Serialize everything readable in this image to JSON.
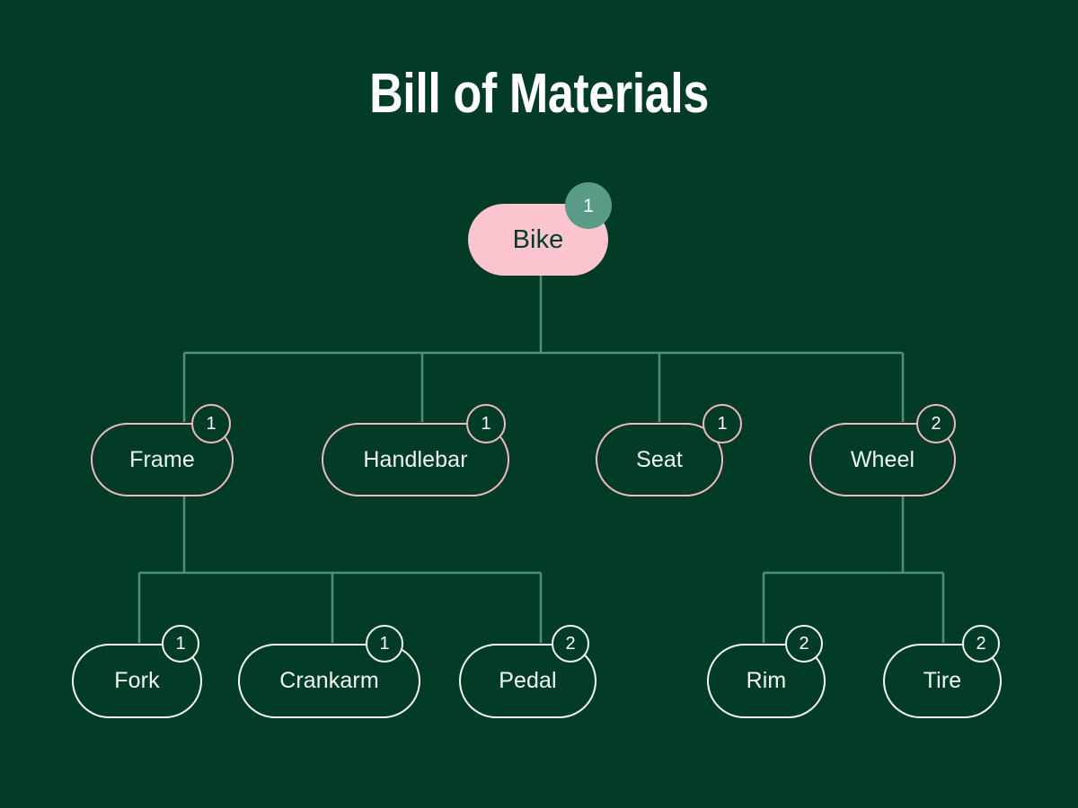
{
  "page": {
    "title": "Bill of Materials",
    "background_color": "#023c27"
  },
  "colors": {
    "background": "#023c27",
    "title_text": "#ffffff",
    "root_fill": "#fbc4ce",
    "root_text": "#023c27",
    "badge_teal_fill": "#5a9b87",
    "pink_outline": "#f2b9c4",
    "white_outline": "#f2f7f4",
    "connector": "#4e9179",
    "node_text": "#f4f9f6"
  },
  "chart_data": {
    "type": "diagram",
    "title": "Bill of Materials",
    "layout": "top-down tree",
    "levels": 3,
    "nodes": [
      {
        "id": "bike",
        "label": "Bike",
        "quantity": "1",
        "level": 0,
        "style": "filled-pink",
        "badge_style": "teal"
      },
      {
        "id": "frame",
        "label": "Frame",
        "quantity": "1",
        "level": 1,
        "style": "outline-pink",
        "badge_style": "pink"
      },
      {
        "id": "handlebar",
        "label": "Handlebar",
        "quantity": "1",
        "level": 1,
        "style": "outline-pink",
        "badge_style": "pink"
      },
      {
        "id": "seat",
        "label": "Seat",
        "quantity": "1",
        "level": 1,
        "style": "outline-pink",
        "badge_style": "pink"
      },
      {
        "id": "wheel",
        "label": "Wheel",
        "quantity": "2",
        "level": 1,
        "style": "outline-pink",
        "badge_style": "pink"
      },
      {
        "id": "fork",
        "label": "Fork",
        "quantity": "1",
        "level": 2,
        "style": "outline-white",
        "badge_style": "white"
      },
      {
        "id": "crankarm",
        "label": "Crankarm",
        "quantity": "1",
        "level": 2,
        "style": "outline-white",
        "badge_style": "white"
      },
      {
        "id": "pedal",
        "label": "Pedal",
        "quantity": "2",
        "level": 2,
        "style": "outline-white",
        "badge_style": "white"
      },
      {
        "id": "rim",
        "label": "Rim",
        "quantity": "2",
        "level": 2,
        "style": "outline-white",
        "badge_style": "white"
      },
      {
        "id": "tire",
        "label": "Tire",
        "quantity": "2",
        "level": 2,
        "style": "outline-white",
        "badge_style": "white"
      }
    ],
    "edges": [
      {
        "from": "bike",
        "to": "frame"
      },
      {
        "from": "bike",
        "to": "handlebar"
      },
      {
        "from": "bike",
        "to": "seat"
      },
      {
        "from": "bike",
        "to": "wheel"
      },
      {
        "from": "frame",
        "to": "fork"
      },
      {
        "from": "frame",
        "to": "crankarm"
      },
      {
        "from": "frame",
        "to": "pedal"
      },
      {
        "from": "wheel",
        "to": "rim"
      },
      {
        "from": "wheel",
        "to": "tire"
      }
    ]
  },
  "nodes": {
    "bike": {
      "label": "Bike",
      "quantity": "1"
    },
    "frame": {
      "label": "Frame",
      "quantity": "1"
    },
    "handlebar": {
      "label": "Handlebar",
      "quantity": "1"
    },
    "seat": {
      "label": "Seat",
      "quantity": "1"
    },
    "wheel": {
      "label": "Wheel",
      "quantity": "2"
    },
    "fork": {
      "label": "Fork",
      "quantity": "1"
    },
    "crankarm": {
      "label": "Crankarm",
      "quantity": "1"
    },
    "pedal": {
      "label": "Pedal",
      "quantity": "2"
    },
    "rim": {
      "label": "Rim",
      "quantity": "2"
    },
    "tire": {
      "label": "Tire",
      "quantity": "2"
    }
  }
}
